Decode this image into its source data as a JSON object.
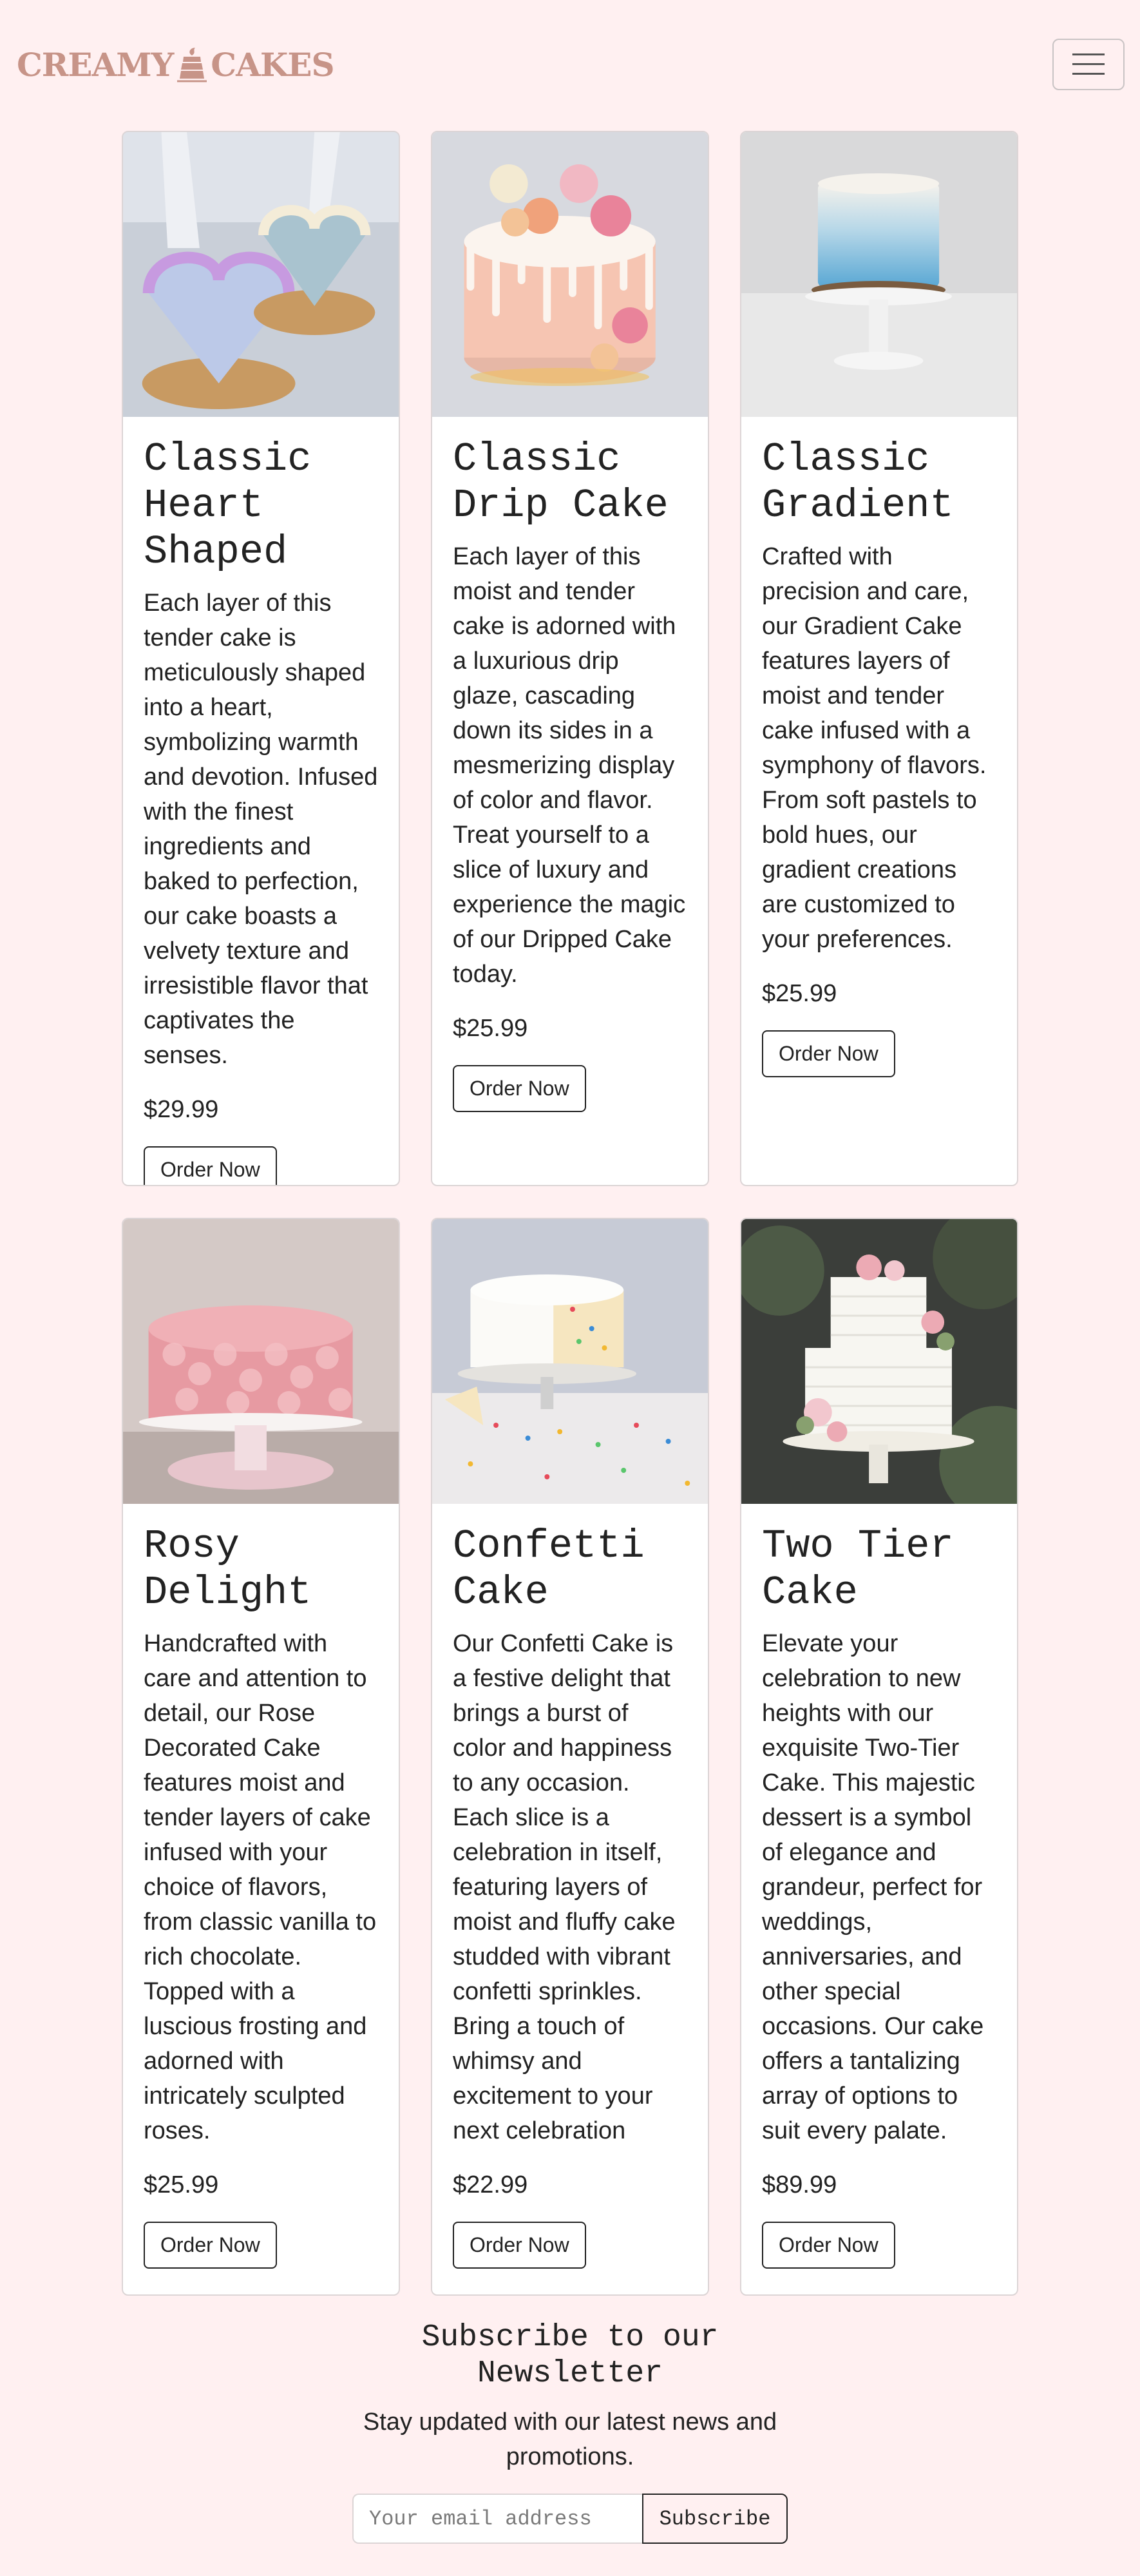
{
  "header": {
    "logo_left": "CREAMY",
    "logo_right": "CAKES",
    "menu_icon": "hamburger-icon"
  },
  "colors": {
    "background": "#fff0f1",
    "logo": "#c79488",
    "card_border": "#dcd5d6"
  },
  "products": [
    {
      "title": "Classic Heart Shaped",
      "description": "Each layer of this tender cake is meticulously shaped into a heart, symbolizing warmth and devotion. Infused with the finest ingredients and baked to perfection, our cake boasts a velvety texture and irresistible flavor that captivates the senses.",
      "price": "$29.99",
      "button": "Order Now",
      "image_alt": "heart-shaped-cakes-photo"
    },
    {
      "title": "Classic Drip Cake",
      "description": "Each layer of this moist and tender cake is adorned with a luxurious drip glaze, cascading down its sides in a mesmerizing display of color and flavor. Treat yourself to a slice of luxury and experience the magic of our Dripped Cake today.",
      "price": "$25.99",
      "button": "Order Now",
      "image_alt": "drip-cake-photo"
    },
    {
      "title": "Classic Gradient",
      "description": "Crafted with precision and care, our Gradient Cake features layers of moist and tender cake infused with a symphony of flavors. From soft pastels to bold hues, our gradient creations are customized to your preferences.",
      "price": "$25.99",
      "button": "Order Now",
      "image_alt": "gradient-cake-photo"
    },
    {
      "title": "Rosy Delight",
      "description": "Handcrafted with care and attention to detail, our Rose Decorated Cake features moist and tender layers of cake infused with your choice of flavors, from classic vanilla to rich chocolate. Topped with a luscious frosting and adorned with intricately sculpted roses.",
      "price": "$25.99",
      "button": "Order Now",
      "image_alt": "rose-cake-photo"
    },
    {
      "title": "Confetti Cake",
      "description": "Our Confetti Cake is a festive delight that brings a burst of color and happiness to any occasion. Each slice is a celebration in itself, featuring layers of moist and fluffy cake studded with vibrant confetti sprinkles. Bring a touch of whimsy and excitement to your next celebration",
      "price": "$22.99",
      "button": "Order Now",
      "image_alt": "confetti-cake-photo"
    },
    {
      "title": "Two Tier Cake",
      "description": "Elevate your celebration to new heights with our exquisite Two-Tier Cake. This majestic dessert is a symbol of elegance and grandeur, perfect for weddings, anniversaries, and other special occasions. Our cake offers a tantalizing array of options to suit every palate.",
      "price": "$89.99",
      "button": "Order Now",
      "image_alt": "two-tier-cake-photo"
    }
  ],
  "newsletter": {
    "title": "Subscribe to our Newsletter",
    "subtitle": "Stay updated with our latest news and promotions.",
    "email_placeholder": "Your email address",
    "email_value": "",
    "button": "Subscribe"
  }
}
